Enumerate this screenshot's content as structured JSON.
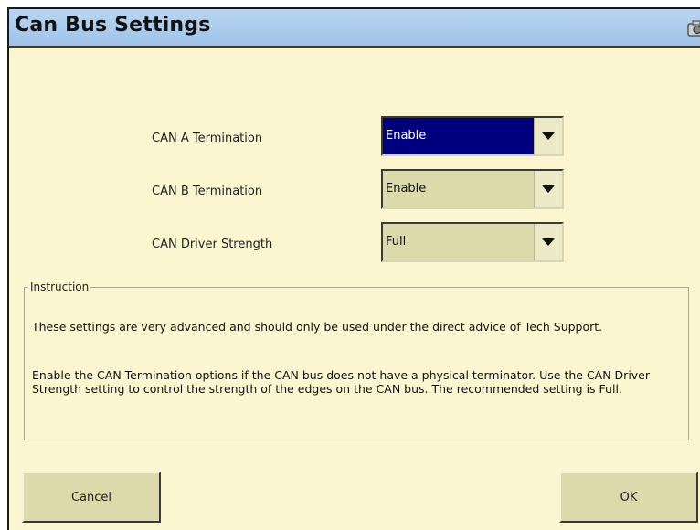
{
  "window": {
    "title": "Can Bus Settings"
  },
  "settings": [
    {
      "label": "CAN A Termination",
      "value": "Enable",
      "active": true
    },
    {
      "label": "CAN B Termination",
      "value": "Enable",
      "active": false
    },
    {
      "label": "CAN Driver Strength",
      "value": "Full",
      "active": false
    }
  ],
  "instruction": {
    "legend": "Instruction",
    "paragraph1": "These settings are very advanced and should only be used under the direct advice of Tech Support.",
    "paragraph2": "Enable the CAN Termination options if the CAN bus does not have a physical terminator. Use the CAN Driver Strength setting to control the strength of the edges on the CAN bus. The recommended setting is Full."
  },
  "buttons": {
    "cancel": "Cancel",
    "ok": "OK"
  },
  "colors": {
    "background": "#fbf6cf",
    "titlebar": "#a8cbec",
    "selected": "#00007f",
    "button": "#dcd9ab"
  },
  "icons": {
    "titlebar": "camera-icon",
    "dropdown": "chevron-down-icon"
  }
}
